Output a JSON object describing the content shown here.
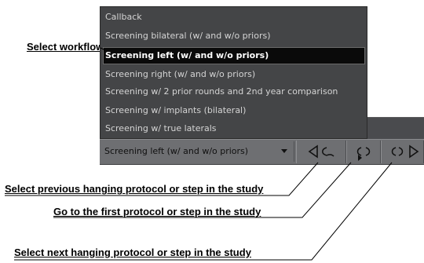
{
  "annotations": {
    "select_workflow": "Select workflow",
    "select_previous": "Select previous hanging protocol or step in the study",
    "go_first": "Go to the first protocol or step in the study",
    "select_next": "Select next hanging protocol or step in the study"
  },
  "workflow_menu": {
    "items": [
      {
        "label": "Callback",
        "selected": false
      },
      {
        "label": "Screening bilateral (w/ and w/o priors)",
        "selected": false
      },
      {
        "label": "Screening left (w/ and w/o priors)",
        "selected": true
      },
      {
        "label": "Screening right (w/ and w/o priors)",
        "selected": false
      },
      {
        "label": "Screening w/ 2 prior rounds and 2nd year comparison",
        "selected": false
      },
      {
        "label": "Screening w/ implants (bilateral)",
        "selected": false
      },
      {
        "label": "Screening w/ true laterals",
        "selected": false
      }
    ]
  },
  "toolbar": {
    "workflow_select_value": "Screening left (w/ and w/o priors)",
    "buttons": [
      {
        "icon": "previous-protocol-icon"
      },
      {
        "icon": "first-protocol-icon"
      },
      {
        "icon": "next-protocol-icon"
      }
    ]
  },
  "colors": {
    "menu_bg": "#444547",
    "menu_text": "#d4d4d4",
    "selected_bg": "#0a0a0a",
    "toolbar_bg": "#6e6f72"
  }
}
